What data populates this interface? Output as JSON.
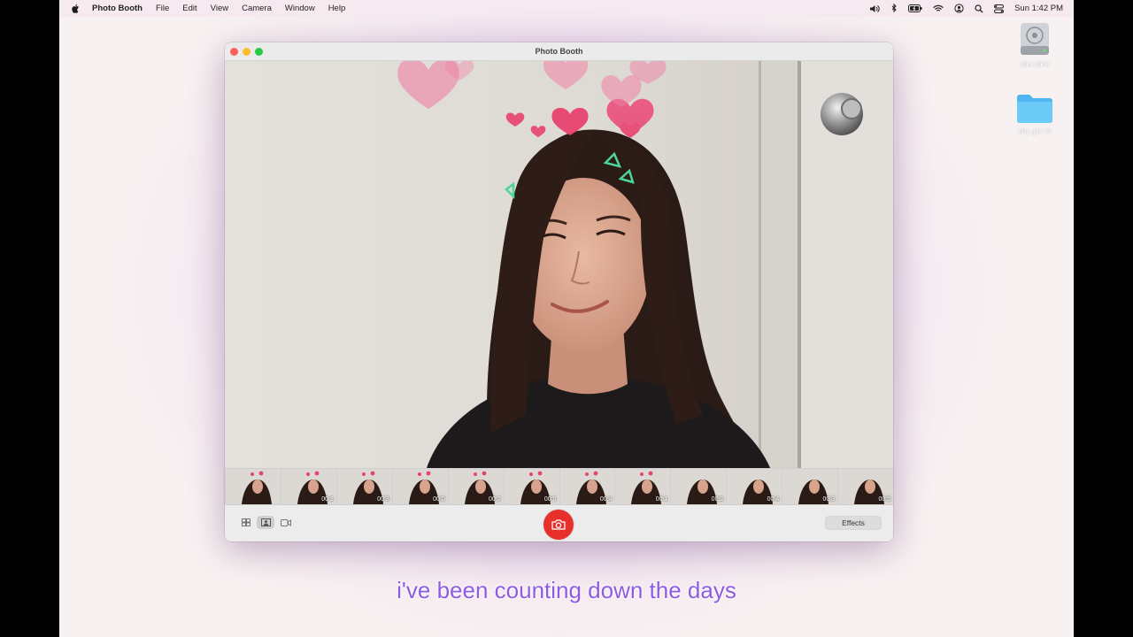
{
  "menubar": {
    "app_name": "Photo Booth",
    "items": [
      "File",
      "Edit",
      "View",
      "Camera",
      "Window",
      "Help"
    ],
    "clock": "Sun 1:42 PM",
    "status_icons": [
      "volume-icon",
      "bluetooth-icon",
      "battery-icon",
      "wifi-icon",
      "user-icon",
      "spotlight-icon",
      "control-center-icon"
    ]
  },
  "desktop": {
    "icons": [
      {
        "label": "wiki-wikie",
        "type": "disk-icon"
      },
      {
        "label": "shy girl <3",
        "type": "folder-icon"
      }
    ]
  },
  "window": {
    "title": "Photo Booth"
  },
  "filmstrip": {
    "durations": [
      "",
      "00:1",
      "00:3",
      "00:0",
      "00:2",
      "00:5",
      "00:4",
      "00:1",
      "00:2",
      "00:4",
      "00:3",
      "00:5"
    ]
  },
  "toolbar": {
    "effects_label": "Effects"
  },
  "caption": "i've been counting down the days",
  "colors": {
    "shutter": "#e8302b",
    "caption": "#8e5be0"
  }
}
